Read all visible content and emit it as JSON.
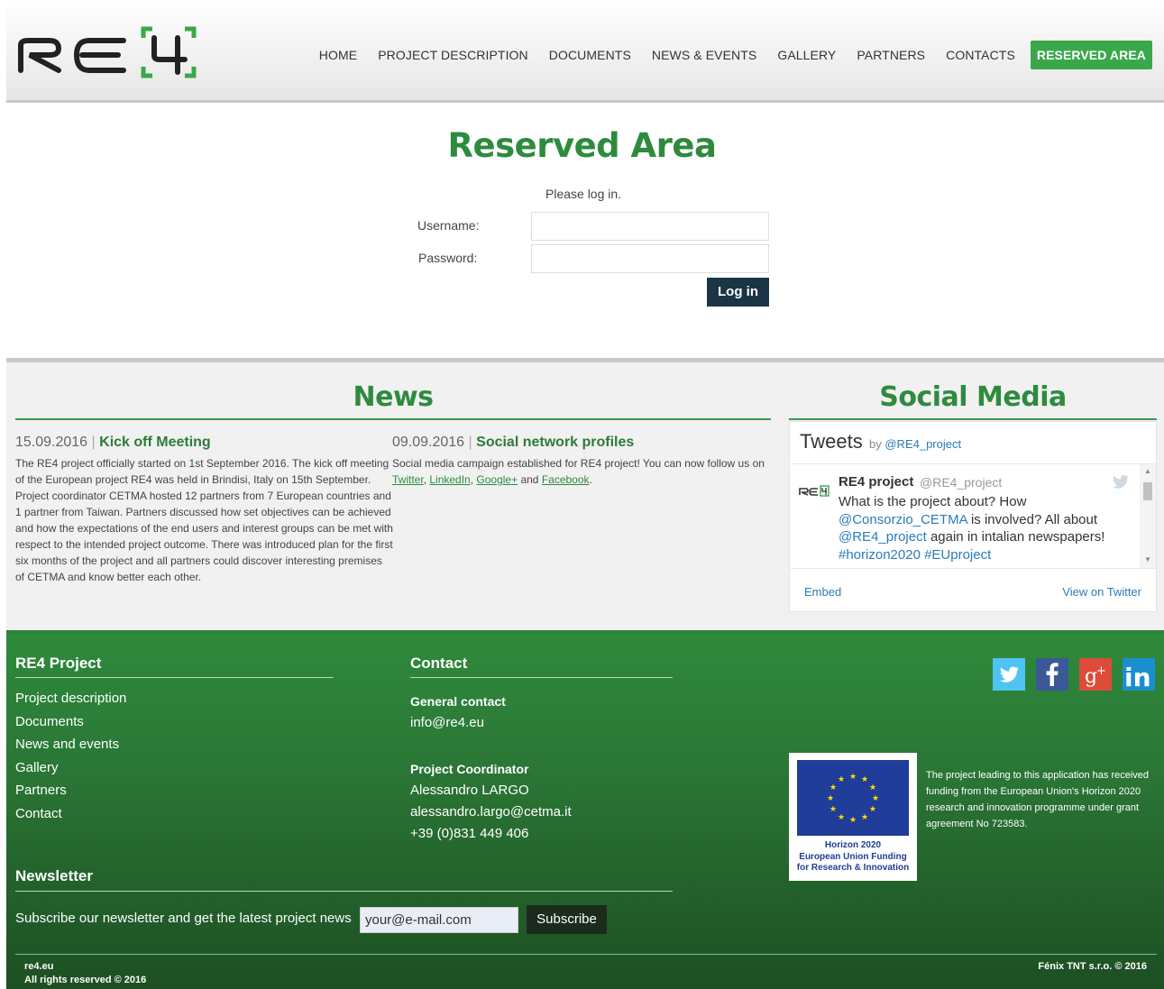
{
  "header": {
    "logo_text": "RE4",
    "nav": [
      "HOME",
      "PROJECT DESCRIPTION",
      "DOCUMENTS",
      "NEWS & EVENTS",
      "GALLERY",
      "PARTNERS",
      "CONTACTS",
      "RESERVED AREA"
    ]
  },
  "login": {
    "title": "Reserved Area",
    "prompt": "Please log in.",
    "username_label": "Username:",
    "password_label": "Password:",
    "username_value": "",
    "password_value": "",
    "button": "Log in"
  },
  "news": {
    "title": "News",
    "items": [
      {
        "date": "15.09.2016",
        "separator": "|",
        "title": "Kick off Meeting",
        "body": "The RE4 project officially started on 1st September 2016. The kick off meeting of the European project RE4 was held in Brindisi, Italy on 15th September. Project coordinator CETMA hosted 12 partners from 7 European countries and 1 partner from Taiwan. Partners discussed how set objectives can be achieved and how the expectations of the end users and interest groups can be met with respect to the intended project outcome. There was introduced plan for the first six months of the project and all partners could discover interesting premises of CETMA and know better each other."
      },
      {
        "date": "09.09.2016",
        "separator": "|",
        "title": "Social network profiles",
        "body_start": "Social media campaign established for RE4 project! You can now follow us on",
        "links": [
          "Twitter",
          "LinkedIn",
          "Google+",
          "Facebook"
        ],
        "and": "and",
        "end": "."
      }
    ]
  },
  "social_media": {
    "title": "Social Media",
    "widget_title": "Tweets",
    "by": "by",
    "by_handle": "@RE4_project",
    "tweet": {
      "name": "RE4 project",
      "handle": "@RE4_project",
      "line1": "What is the project about? How",
      "mention1": "@Consorzio_CETMA",
      "line2": " is involved? All about",
      "mention2": "@RE4_project",
      "line3": " again in intalian newspapers!",
      "hashtags": "#horizon2020 #EUproject"
    },
    "embed": "Embed",
    "view_on": "View on Twitter"
  },
  "footer": {
    "project_heading": "RE4 Project",
    "project_links": [
      "Project description",
      "Documents",
      "News and events",
      "Gallery",
      "Partners",
      "Contact"
    ],
    "contact_heading": "Contact",
    "general_contact_label": "General contact",
    "general_email": "info@re4.eu",
    "coordinator_label": "Project Coordinator",
    "coordinator_name": "Alessandro LARGO",
    "coordinator_email": "alessandro.largo@cetma.it",
    "coordinator_phone": "+39 (0)831 449 406",
    "eu_caption": [
      "Horizon 2020",
      "European Union Funding",
      "for Research & Innovation"
    ],
    "eu_text": "The project leading to this application has received funding from the European Union's Horizon 2020 research and innovation programme under grant agreement No 723583.",
    "newsletter_heading": "Newsletter",
    "newsletter_text": "Subscribe our newsletter and get the latest project news",
    "newsletter_placeholder": "your@e-mail.com",
    "subscribe": "Subscribe",
    "site": "re4.eu",
    "rights": "All rights reserved © 2016",
    "credit": "Fénix TNT s.r.o. © 2016",
    "social_icons": [
      "twitter-icon",
      "facebook-icon",
      "google-plus-icon",
      "linkedin-icon"
    ]
  },
  "colors": {
    "brand_green": "#3aa84a",
    "title_green": "#2e8b3e",
    "navy": "#1b3547",
    "twitter_blue": "#2b7bb9"
  }
}
